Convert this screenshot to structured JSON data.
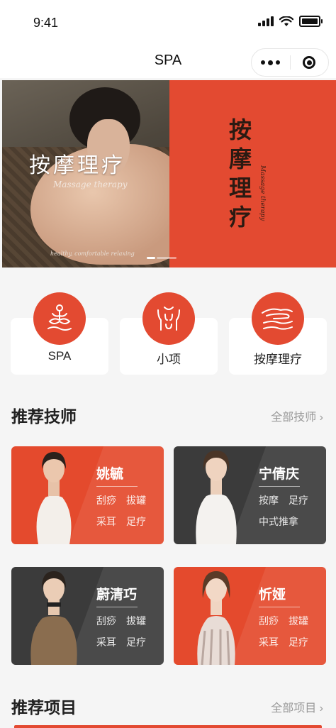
{
  "status": {
    "time": "9:41"
  },
  "navbar": {
    "title": "SPA"
  },
  "banner": {
    "slide1": {
      "title": "按摩理疗",
      "subtitle": "Massage therapy",
      "tagline": "healthy, comfortable relaxing"
    },
    "slide2": {
      "title": "按摩理疗",
      "subtitle": "Massage therapy"
    },
    "pages": 2,
    "active_page": 1
  },
  "categories": [
    {
      "label": "SPA",
      "icon": "lotus-meditation-icon"
    },
    {
      "label": "小项",
      "icon": "body-torso-icon"
    },
    {
      "label": "按摩理疗",
      "icon": "hand-massage-icon"
    }
  ],
  "technicians_section": {
    "title": "推荐技师",
    "more": "全部技师"
  },
  "technicians": [
    {
      "name": "姚毓",
      "tags": [
        "刮痧",
        "拔罐",
        "采耳",
        "足疗"
      ],
      "theme": "red"
    },
    {
      "name": "宁倩庆",
      "tags": [
        "按摩",
        "足疗",
        "中式推拿"
      ],
      "theme": "dark"
    },
    {
      "name": "蔚清巧",
      "tags": [
        "刮痧",
        "拔罐",
        "采耳",
        "足疗"
      ],
      "theme": "dark"
    },
    {
      "name": "忻娅",
      "tags": [
        "刮痧",
        "拔罐",
        "采耳",
        "足疗"
      ],
      "theme": "red"
    }
  ],
  "projects_section": {
    "title": "推荐项目",
    "more": "全部项目"
  },
  "colors": {
    "accent": "#e34a31",
    "dark_card": "#3b3b3b",
    "background": "#f5f5f5"
  }
}
